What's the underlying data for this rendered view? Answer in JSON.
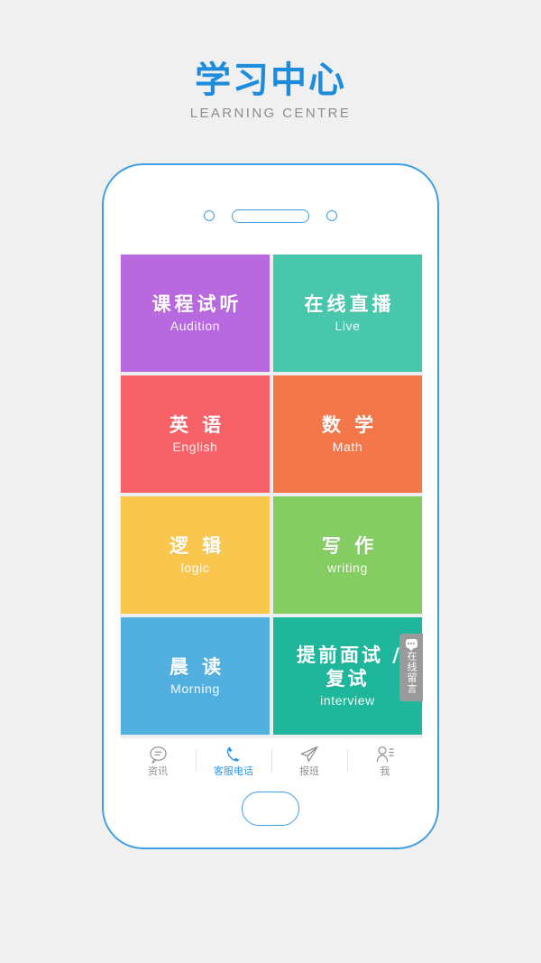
{
  "header": {
    "title_cn": "学习中心",
    "title_en": "LEARNING CENTRE",
    "title_color": "#1e8cdd"
  },
  "phone": {
    "frame_color": "#3f9fe0",
    "screen_bg": "#eceef0"
  },
  "grid": {
    "tiles": [
      {
        "cn": "课程试听",
        "en": "Audition",
        "color": "#b869e0"
      },
      {
        "cn": "在线直播",
        "en": "Live",
        "color": "#49c7ac"
      },
      {
        "cn": "英 语",
        "en": "English",
        "color": "#f76268"
      },
      {
        "cn": "数 学",
        "en": "Math",
        "color": "#f4774a"
      },
      {
        "cn": "逻 辑",
        "en": "logic",
        "color": "#f9c64e"
      },
      {
        "cn": "写 作",
        "en": "writing",
        "color": "#85cc63"
      },
      {
        "cn": "晨 读",
        "en": "Morning",
        "color": "#52b0e0"
      },
      {
        "cn": "提前面试 /\n复试",
        "en": "interview",
        "color": "#1fb79b"
      }
    ]
  },
  "side_tab": {
    "label": "在线留言",
    "icon": "message-bubble-icon",
    "bg_color": "#9a9a9a"
  },
  "bottom_nav": {
    "active_color": "#2a96e8",
    "inactive_color": "#8d8d8d",
    "items": [
      {
        "label": "资讯",
        "icon": "chat-bubble-icon",
        "active": false
      },
      {
        "label": "客服电话",
        "icon": "phone-icon",
        "active": true
      },
      {
        "label": "报班",
        "icon": "paper-plane-icon",
        "active": false
      },
      {
        "label": "我",
        "icon": "person-icon",
        "active": false
      }
    ]
  }
}
